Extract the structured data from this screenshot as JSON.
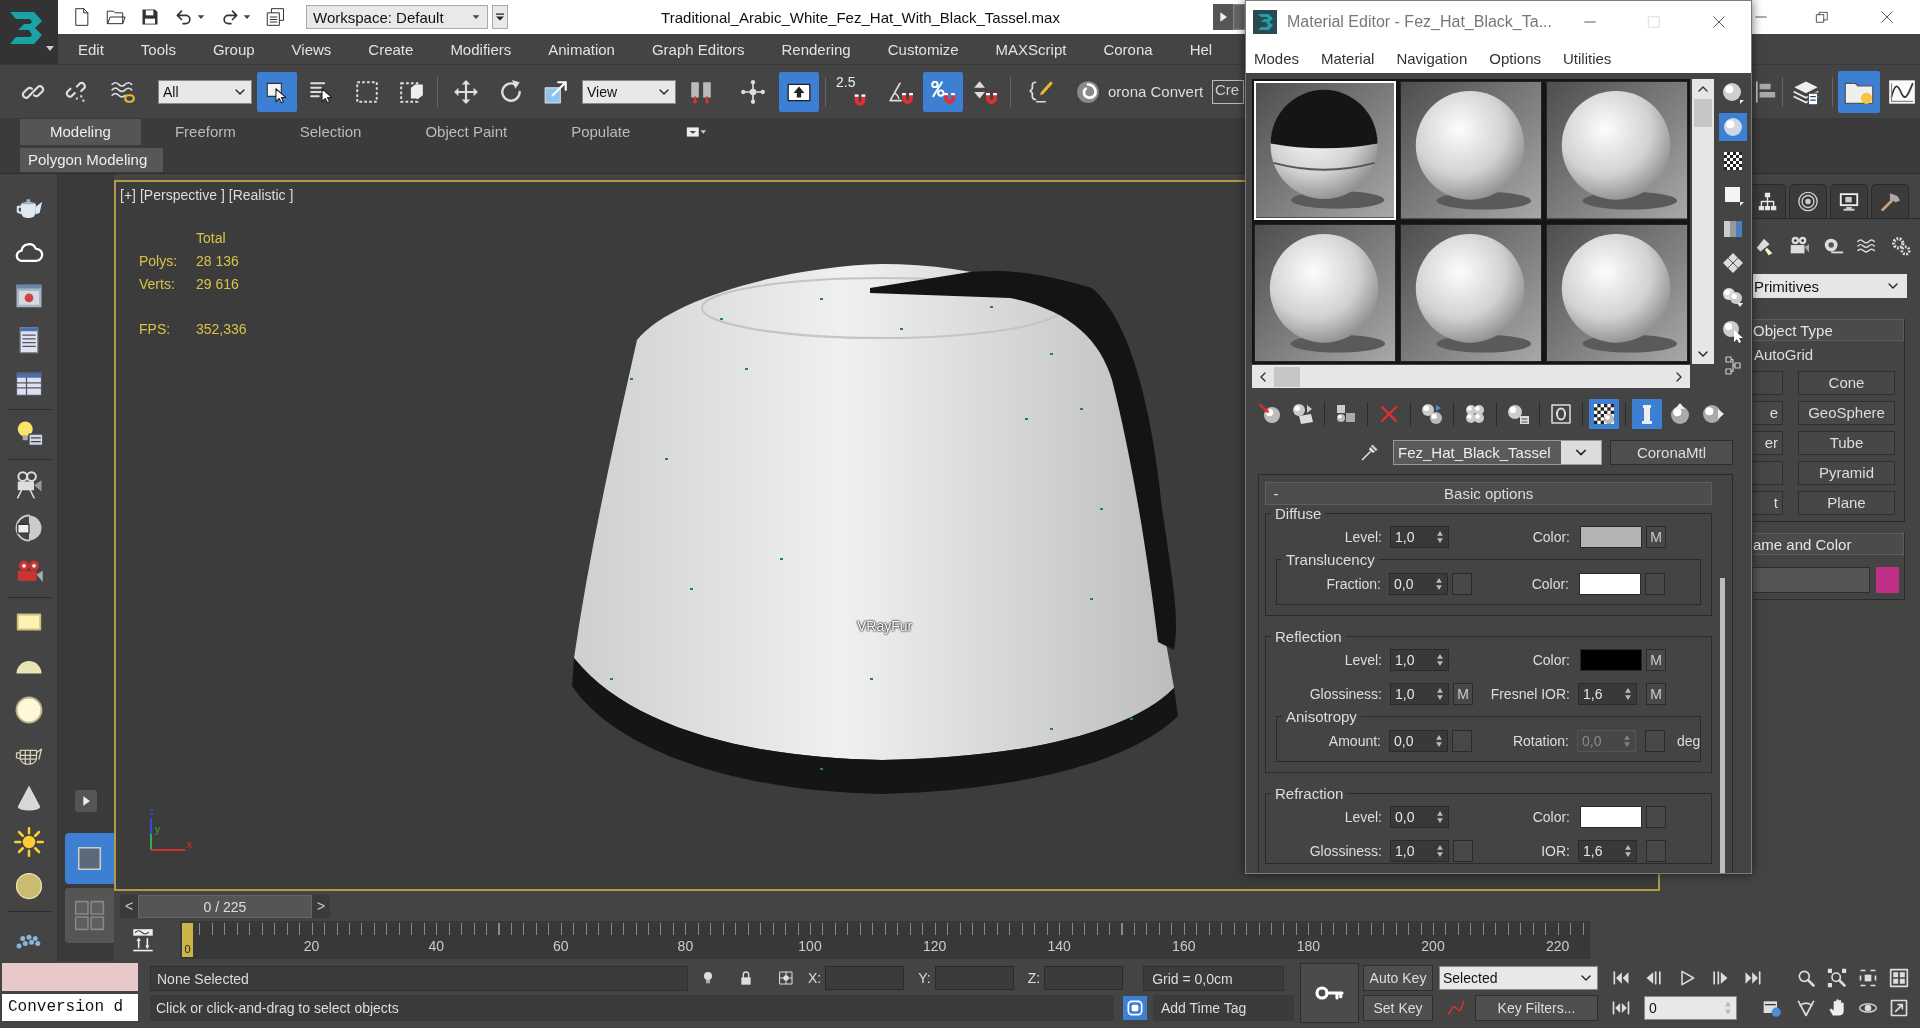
{
  "title_bar": {
    "workspace": "Workspace: Default",
    "title": "Traditional_Arabic_White_Fez_Hat_With_Black_Tassel.max"
  },
  "menu_bar": [
    "Edit",
    "Tools",
    "Group",
    "Views",
    "Create",
    "Modifiers",
    "Animation",
    "Graph Editors",
    "Rendering",
    "Customize",
    "MAXScript",
    "Corona",
    "Hel"
  ],
  "main_toolbar": {
    "selection_filter": "All",
    "coordinate_system": "View",
    "snap_label": "2.5",
    "converter_label": "orona Convert",
    "selection_set": "Cre",
    "buttons": [
      {
        "on": false
      },
      {
        "on": false
      },
      {
        "on": false
      },
      {
        "on": true
      },
      {
        "on": false
      },
      {
        "on": false
      },
      {
        "on": false
      },
      {
        "on": false
      },
      {
        "on": false
      },
      {
        "on": false
      },
      {
        "on": false
      },
      {
        "on": false
      },
      {
        "on": true
      },
      {
        "on": false
      },
      {
        "on": false
      },
      {
        "on": true
      },
      {
        "on": false
      },
      {
        "on": false
      },
      {
        "on": false
      },
      {
        "on": false
      },
      {
        "on": false
      },
      {
        "on": true
      },
      {
        "on": false
      }
    ]
  },
  "ribbon": {
    "tabs": [
      {
        "label": "Modeling",
        "selected": true
      },
      {
        "label": "Freeform",
        "selected": false
      },
      {
        "label": "Selection",
        "selected": false
      },
      {
        "label": "Object Paint",
        "selected": false
      },
      {
        "label": "Populate",
        "selected": false
      }
    ],
    "panel_title": "Polygon Modeling"
  },
  "viewport": {
    "active": true,
    "labels": [
      "[+]",
      "[Perspective ]",
      "[Realistic ]"
    ],
    "stats_header": "Total",
    "stats": [
      {
        "label": "Polys:",
        "value": "28 136"
      },
      {
        "label": "Verts:",
        "value": "29 616"
      }
    ],
    "fps_label": "FPS:",
    "fps": "352,336",
    "object_label": "VRayFur",
    "axes": [
      "z",
      "y",
      "x"
    ]
  },
  "viewport_layouts": [
    {
      "selected": true
    },
    {
      "selected": false
    }
  ],
  "time_slider": {
    "prev": "<",
    "position": "0 / 225",
    "next": ">"
  },
  "track_bar": {
    "current": "0",
    "ticks": [
      "20",
      "40",
      "60",
      "80",
      "100",
      "120",
      "140",
      "160",
      "180",
      "200",
      "220"
    ]
  },
  "status_bar": {
    "listener_output": "Conversion d",
    "selection": "None Selected",
    "prompt": "Click or click-and-drag to select objects",
    "coords": [
      "X:",
      "Y:",
      "Z:"
    ],
    "grid": "Grid = 0,0cm",
    "toggle_on": true,
    "time_tag": "Add Time Tag",
    "auto_key": "Auto Key",
    "auto_key_on": false,
    "set_key": "Set Key",
    "key_set": "Selected",
    "key_filters": "Key Filters...",
    "frame": "0"
  },
  "material_editor": {
    "title": "Material Editor - Fez_Hat_Black_Ta...",
    "menu": [
      "Modes",
      "Material",
      "Navigation",
      "Options",
      "Utilities"
    ],
    "slots": [
      {
        "kind": "fez",
        "selected": true
      },
      {
        "kind": "plain",
        "selected": false
      },
      {
        "kind": "plain",
        "selected": false
      },
      {
        "kind": "plain",
        "selected": false
      },
      {
        "kind": "plain",
        "selected": false
      },
      {
        "kind": "plain",
        "selected": false
      }
    ],
    "side_tools": [
      {
        "on": false
      },
      {
        "on": true
      },
      {
        "on": false
      },
      {
        "on": false
      },
      {
        "on": false
      },
      {
        "on": false
      },
      {
        "on": false
      },
      {
        "on": false
      },
      {
        "on": false
      }
    ],
    "tools": [
      {
        "on": false
      },
      {
        "on": false
      },
      {
        "on": false
      },
      {
        "on": false
      },
      {
        "on": false
      },
      {
        "on": false
      },
      {
        "on": false
      },
      {
        "on": false
      },
      {
        "on": true
      },
      {
        "on": true
      },
      {
        "on": false
      },
      {
        "on": false
      }
    ],
    "material_name": "Fez_Hat_Black_Tassel",
    "material_type": "CoronaMtl",
    "rollout": {
      "toggle": "-",
      "title": "Basic options",
      "groups": [
        {
          "title": "Diffuse",
          "rows": [
            {
              "cells": [
                {
                  "label": "Level:",
                  "kind": "spinner",
                  "value": "1,0",
                  "disabled": false
                },
                {
                  "label": "Color:",
                  "kind": "color",
                  "color": "#b4b4b4",
                  "map": "M"
                }
              ]
            }
          ],
          "subgroup": {
            "title": "Translucency",
            "rows": [
              {
                "cells": [
                  {
                    "label": "Fraction:",
                    "kind": "spinner",
                    "value": "0,0",
                    "slot": true,
                    "disabled": false
                  },
                  {
                    "label": "Color:",
                    "kind": "color",
                    "color": "#ffffff",
                    "slot": true
                  }
                ]
              }
            ]
          }
        },
        {
          "title": "Reflection",
          "rows": [
            {
              "cells": [
                {
                  "label": "Level:",
                  "kind": "spinner",
                  "value": "1,0",
                  "disabled": false
                },
                {
                  "label": "Color:",
                  "kind": "color",
                  "color": "#000000",
                  "map": "M"
                }
              ]
            },
            {
              "cells": [
                {
                  "label": "Glossiness:",
                  "kind": "spinner",
                  "value": "1,0",
                  "map": "M",
                  "disabled": false
                },
                {
                  "label": "Fresnel IOR:",
                  "kind": "spinner",
                  "value": "1,6",
                  "map": "M",
                  "disabled": false
                }
              ]
            }
          ],
          "subgroup": {
            "title": "Anisotropy",
            "rows": [
              {
                "cells": [
                  {
                    "label": "Amount:",
                    "kind": "spinner",
                    "value": "0,0",
                    "slot": true,
                    "disabled": false
                  },
                  {
                    "label": "Rotation:",
                    "kind": "spinner",
                    "value": "0,0",
                    "slot": true,
                    "disabled": true,
                    "unit": "deg"
                  }
                ]
              }
            ]
          }
        },
        {
          "title": "Refraction",
          "rows": [
            {
              "cells": [
                {
                  "label": "Level:",
                  "kind": "spinner",
                  "value": "0,0",
                  "disabled": false
                },
                {
                  "label": "Color:",
                  "kind": "color",
                  "color": "#ffffff",
                  "slot": true
                }
              ]
            },
            {
              "cells": [
                {
                  "label": "Glossiness:",
                  "kind": "spinner",
                  "value": "1,0",
                  "slot": true,
                  "disabled": false
                },
                {
                  "label": "IOR:",
                  "kind": "spinner",
                  "value": "1,6",
                  "slot": true,
                  "disabled": false
                }
              ]
            }
          ]
        }
      ]
    }
  },
  "command_panel": {
    "tabs": [
      {
        "selected": false
      },
      {
        "selected": false
      },
      {
        "selected": false
      },
      {
        "selected": false
      }
    ],
    "categories": [
      {
        "selected": false
      },
      {
        "selected": false
      },
      {
        "selected": false
      },
      {
        "selected": false
      },
      {
        "selected": false
      }
    ],
    "dropdown": "Primitives",
    "object_type": {
      "title": "Object Type",
      "autogrid": "AutoGrid",
      "buttons": [
        {
          "right": "Cone"
        },
        {
          "left": "e",
          "right": "GeoSphere"
        },
        {
          "left": "er",
          "right": "Tube"
        },
        {
          "right": "Pyramid"
        },
        {
          "left": "t",
          "right": "Plane"
        }
      ]
    },
    "name_color": {
      "title": "ame and Color",
      "color": "#c02f86"
    }
  }
}
